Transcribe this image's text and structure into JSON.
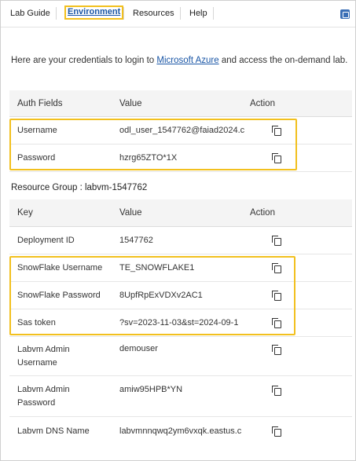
{
  "tabs": [
    {
      "label": "Lab Guide"
    },
    {
      "label": "Environment"
    },
    {
      "label": "Resources"
    },
    {
      "label": "Help"
    }
  ],
  "intro": {
    "before": "Here are your credentials to login to ",
    "link": "Microsoft Azure",
    "after": " and access the on-demand lab."
  },
  "auth_table": {
    "headers": [
      "Auth Fields",
      "Value",
      "Action"
    ],
    "rows": [
      {
        "field": "Username",
        "value": "odl_user_1547762@faiad2024.c"
      },
      {
        "field": "Password",
        "value": "hzrg65ZTO*1X"
      }
    ]
  },
  "resource_group": "Resource Group : labvm-1547762",
  "resource_table": {
    "headers": [
      "Key",
      "Value",
      "Action"
    ],
    "rows": [
      {
        "key": "Deployment ID",
        "value": "1547762"
      },
      {
        "key": "SnowFlake Username",
        "value": "TE_SNOWFLAKE1"
      },
      {
        "key": "SnowFlake Password",
        "value": "8UpfRpExVDXv2AC1"
      },
      {
        "key": "Sas token",
        "value": "?sv=2023-11-03&st=2024-09-1"
      },
      {
        "key": "Labvm Admin Username",
        "value": "demouser"
      },
      {
        "key": "Labvm Admin Password",
        "value": "amiw95HPB*YN"
      },
      {
        "key": "Labvm DNS Name",
        "value": "labvmnnqwq2ym6vxqk.eastus.c"
      }
    ]
  },
  "colors": {
    "highlight": "#f2c01e",
    "link": "#1a56a6",
    "header_bg": "#f4f4f4"
  },
  "icons": [
    "copy-icon",
    "popout-icon"
  ]
}
